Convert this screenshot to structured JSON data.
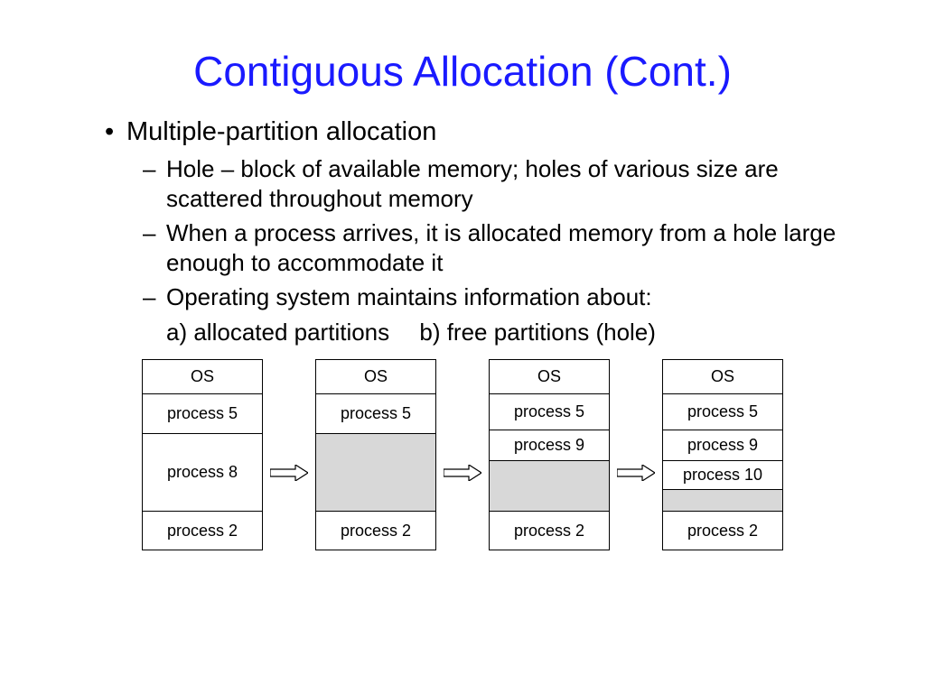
{
  "title": "Contiguous Allocation (Cont.)",
  "bullets": {
    "main": "Multiple-partition allocation",
    "sub1": "Hole – block of available memory; holes of various size are scattered throughout memory",
    "sub2": "When a process arrives, it is allocated memory from a hole large enough to accommodate it",
    "sub3": "Operating system maintains information about:",
    "sub3_line2": "a) allocated partitions  b) free partitions (hole)"
  },
  "mem": {
    "b1": {
      "os": "OS",
      "p5": "process 5",
      "p8": "process 8",
      "p2": "process 2"
    },
    "b2": {
      "os": "OS",
      "p5": "process 5",
      "p2": "process 2"
    },
    "b3": {
      "os": "OS",
      "p5": "process 5",
      "p9": "process 9",
      "p2": "process 2"
    },
    "b4": {
      "os": "OS",
      "p5": "process 5",
      "p9": "process 9",
      "p10": "process 10",
      "p2": "process 2"
    }
  }
}
